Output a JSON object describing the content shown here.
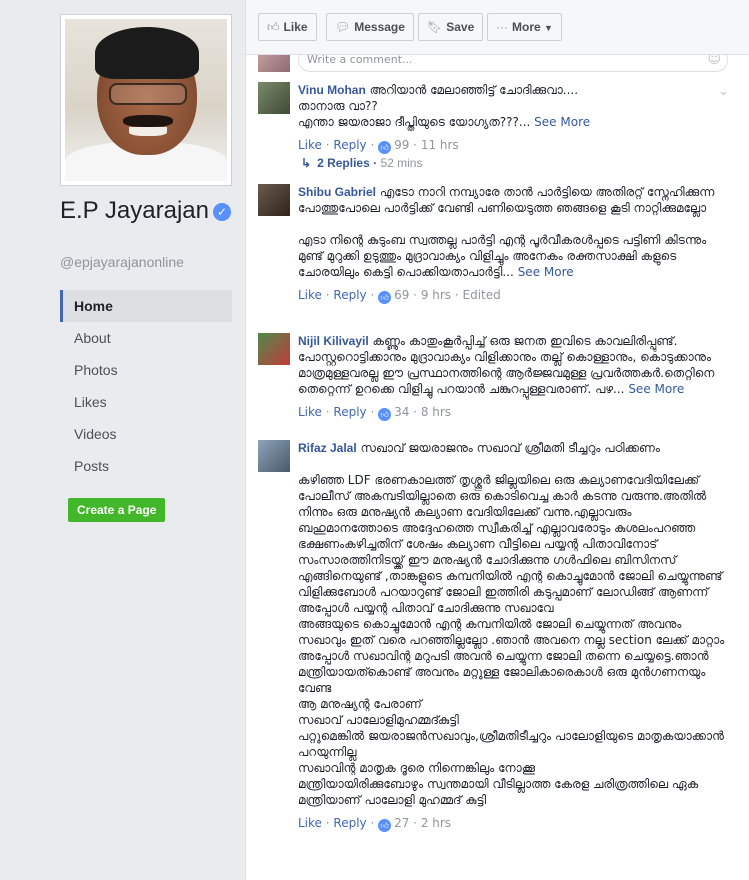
{
  "page": {
    "name": "E.P Jayarajan",
    "handle": "@epjayarajanonline",
    "nav": [
      "Home",
      "About",
      "Photos",
      "Likes",
      "Videos",
      "Posts"
    ],
    "create_page": "Create a Page"
  },
  "toolbar": {
    "like": "Like",
    "message": "Message",
    "save": "Save",
    "more": "More"
  },
  "comment_input": {
    "placeholder": "Write a comment..."
  },
  "comments": [
    {
      "name": "Vinu Mohan",
      "text": "അറിയാൻ മേലാഞ്ഞിട്ട് ചോദിക്കുവാ....\nതാനാരു വാ??\nഎന്താ ജയരാജാ ദീപ്തിയുടെ യോഗ്യത???...",
      "see_more": "See More",
      "like": "Like",
      "reply": "Reply",
      "likes": "99",
      "time": "11 hrs",
      "replies": "2 Replies",
      "replies_time": "52 mins"
    },
    {
      "name": "Shibu Gabriel",
      "text": "എടോ നാറി നമ്പ്യാരേ താൻ പാർട്ടിയെ അതിരറ്റ് സ്നേഹിക്കുന്ന പോത്തുപോലെ പാർട്ടിക്ക് വേണ്ടി പണിയെടുത്ത ഞങ്ങളെ കൂടി നാറ്റിക്കുമല്ലോ\n\nഎടാ നിന്റെ കുടുംബ സ്വത്തല്ല പാർട്ടി എന്റ പൂർവീകരൾപ്പടെ പട്ടിണി കിടന്നും മുണ്ട് മുറുക്കി ഉടുത്തും മുദ്രാവാക്യം വിളിച്ചും അനേകം രക്തസാക്ഷി കളുടെ ചോരയിലും കെട്ടി പൊക്കിയതാപാർട്ടി...",
      "see_more": "See More",
      "like": "Like",
      "reply": "Reply",
      "likes": "69",
      "time": "9 hrs",
      "edited": "Edited"
    },
    {
      "name": "Nijil Kilivayil",
      "text": "കണ്ണും കാതുംകൂർപ്പിച്ച് ഒരു ജനത ഇവിടെ കാവലിരിപ്പുണ്ട്. പോസ്റ്ററൊട്ടിക്കാനും മുദ്രാവാക്യം വിളിക്കാനും തല്ല് കൊള്ളാനും, കൊടുക്കാനും മാത്രമുള്ളവരല്ല ഈ പ്രസ്ഥാനത്തിന്റെ ആർജ്ജവമുള്ള പ്രവർത്തകർ.തെറ്റിനെ തെറ്റെന്ന് ഉറക്കെ വിളിച്ചു പറയാൻ ചങ്കുറപ്പുള്ളവരാണ്. പഴ...",
      "see_more": "See More",
      "like": "Like",
      "reply": "Reply",
      "likes": "34",
      "time": "8 hrs"
    },
    {
      "name": "Rifaz Jalal",
      "text": "സഖാവ് ജയരാജനും സഖാവ് ശ്രീമതി ടീച്ചറും പഠിക്കണം\n\nകഴിഞ്ഞ LDF ഭരണകാലത്ത് തൃശ്ശൂർ ജില്ലയിലെ ഒരു കല്യാണവേദിയിലേക്ക് പോലീസ് അകമ്പടിയില്ലാതെ ഒരു കൊടിവെച്ച കാർ കടന്നു വരുന്നു.അതിൽ നിന്നും ഒരു മനുഷ്യൻ കല്യാണ വേദിയിലേക്ക് വന്നു.എല്ലാവരും ബഹുമാനത്തോടെ അദ്ദേഹത്തെ സ്വീകരിച്ച് എല്ലാവരോടും കുശലംപറഞ്ഞ ഭക്ഷണംകഴിച്ചതിന് ശേഷം കല്യാണ വീട്ടിലെ പയ്യന്റ പിതാവിനോട് സംസാരത്തിനിടയ്ക്ക് ഈ മനുഷ്യൻ ചോദിക്കുന്നു ഗൾഫിലെ ബിസിനസ് എങ്ങിനെയുണ്ട് ,താങ്കളുടെ കമ്പനിയിൽ എന്റ കൊച്ചുമോൻ ജോലി ചെയ്യുന്നുണ്ട്\nവിളിക്കുബോൾ പറയാറുണ്ട് ജോലി ഇത്തിരി കടുപ്പമാണ് ലോഡിങ്ങ് ആണന്ന്\nഅപ്പോൾ പയ്യന്റ പിതാവ് ചോദിക്കുന്നു സഖാവേ\nഅങ്ങയുടെ കൊച്ചുമോൻ എന്റ കമ്പനിയിൽ ജോലി ചെയ്യുന്നത് അവനും സഖാവും ഇത് വരെ പറഞ്ഞില്ലല്ലോ .ഞാൻ അവനെ നല്ല section ലേക്ക് മാറ്റാം\nഅപ്പോൾ സഖാവിന്റ മറുപടി അവൻ ചെയ്യുന്ന ജോലി തന്നെ ചെയ്യട്ടെ.ഞാൻ മന്ത്രിയായത്കൊണ്ട് അവനും മറ്റുള്ള ജോലികാരെകാൾ ഒരു മുൻഗണനയും വേണ്ട\nആ മനുഷ്യന്റ പേരാണ്\nസഖാവ് പാലോളിമുഹമ്മദ്കുട്ടി\nപറ്റുമെങ്കിൽ ജയരാജൻസഖാവും,ശ്രീമതിടീച്ചറും പാലോളിയുടെ മാതൃകയാക്കാൻ പറയുന്നില്ല\nസഖാവിന്റ മാതൃക ദൂരെ നിന്നെങ്കിലും നോക്കൂ\nമന്ത്രിയായിരിക്കുബോഴും സ്വന്തമായി വീടില്ലാത്ത കേരള ചരിത്രത്തിലെ ഏക മന്ത്രിയാണ് പാലോളി മുഹമ്മദ് കുട്ടി",
      "like": "Like",
      "reply": "Reply",
      "likes": "27",
      "time": "2 hrs"
    }
  ],
  "colors": {
    "link": "#365899",
    "accent": "#4267b2",
    "create_button": "#42b72a",
    "like_badge": "#5890ff"
  }
}
